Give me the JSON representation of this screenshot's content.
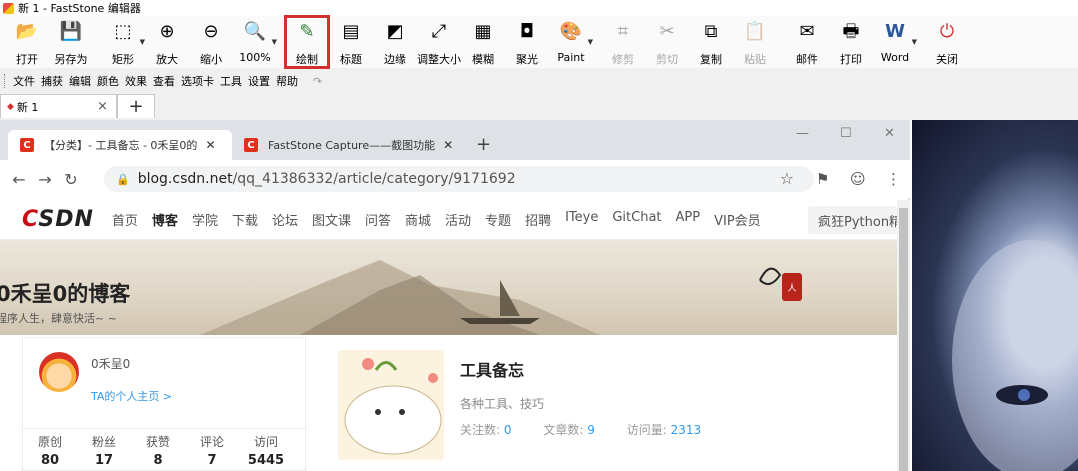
{
  "window": {
    "title": "新 1 - FastStone 编辑器"
  },
  "toolbar": {
    "tools": [
      {
        "label": "打开",
        "icon": "open-folder-icon",
        "glyph": "📂",
        "disabled": false,
        "caret": false,
        "highlight": false
      },
      {
        "label": "另存为",
        "icon": "save-icon",
        "glyph": "💾",
        "disabled": false,
        "caret": false,
        "highlight": false
      },
      {
        "label": "矩形",
        "icon": "rect-select-icon",
        "glyph": "⬚",
        "disabled": false,
        "caret": true,
        "highlight": false
      },
      {
        "label": "放大",
        "icon": "zoom-in-icon",
        "glyph": "⊕",
        "disabled": false,
        "caret": false,
        "highlight": false
      },
      {
        "label": "缩小",
        "icon": "zoom-out-icon",
        "glyph": "⊖",
        "disabled": false,
        "caret": false,
        "highlight": false
      },
      {
        "label": "100%",
        "icon": "zoom-100-icon",
        "glyph": "🔍",
        "disabled": false,
        "caret": true,
        "highlight": false
      },
      {
        "label": "绘制",
        "icon": "draw-icon",
        "glyph": "✎",
        "disabled": false,
        "caret": false,
        "highlight": true
      },
      {
        "label": "标题",
        "icon": "caption-icon",
        "glyph": "▤",
        "disabled": false,
        "caret": false,
        "highlight": false
      },
      {
        "label": "边缘",
        "icon": "edge-icon",
        "glyph": "◩",
        "disabled": false,
        "caret": false,
        "highlight": false
      },
      {
        "label": "调整大小",
        "icon": "resize-icon",
        "glyph": "⤢",
        "disabled": false,
        "caret": false,
        "highlight": false
      },
      {
        "label": "模糊",
        "icon": "blur-icon",
        "glyph": "▦",
        "disabled": false,
        "caret": false,
        "highlight": false
      },
      {
        "label": "聚光",
        "icon": "spotlight-icon",
        "glyph": "◘",
        "disabled": false,
        "caret": false,
        "highlight": false
      },
      {
        "label": "Paint",
        "icon": "paint-icon",
        "glyph": "🎨",
        "disabled": false,
        "caret": true,
        "highlight": false
      },
      {
        "label": "修剪",
        "icon": "crop-icon",
        "glyph": "⌗",
        "disabled": true,
        "caret": false,
        "highlight": false
      },
      {
        "label": "剪切",
        "icon": "cut-icon",
        "glyph": "✂",
        "disabled": true,
        "caret": false,
        "highlight": false
      },
      {
        "label": "复制",
        "icon": "copy-icon",
        "glyph": "⧉",
        "disabled": false,
        "caret": false,
        "highlight": false
      },
      {
        "label": "粘贴",
        "icon": "paste-icon",
        "glyph": "📋",
        "disabled": true,
        "caret": false,
        "highlight": false
      },
      {
        "label": "邮件",
        "icon": "mail-icon",
        "glyph": "✉",
        "disabled": false,
        "caret": false,
        "highlight": false
      },
      {
        "label": "打印",
        "icon": "print-icon",
        "glyph": "🖶",
        "disabled": false,
        "caret": false,
        "highlight": false
      },
      {
        "label": "Word",
        "icon": "word-icon",
        "glyph": "W",
        "disabled": false,
        "caret": true,
        "highlight": false
      },
      {
        "label": "关闭",
        "icon": "power-icon",
        "glyph": "⏻",
        "disabled": false,
        "caret": false,
        "highlight": false
      }
    ]
  },
  "menubar": {
    "items": [
      "文件",
      "捕获",
      "编辑",
      "颜色",
      "效果",
      "查看",
      "选项卡",
      "工具",
      "设置",
      "帮助"
    ]
  },
  "doctabs": {
    "active_label": "新 1"
  },
  "browser": {
    "tab1_title": "【分类】- 工具备忘 - 0禾呈0的",
    "tab2_title": "FastStone Capture——截图功能",
    "url_domain": "blog.csdn.net",
    "url_path": "/qq_41386332/article/category/9171692",
    "nav": [
      "首页",
      "博客",
      "学院",
      "下载",
      "论坛",
      "图文课",
      "问答",
      "商城",
      "活动",
      "专题",
      "招聘",
      "ITeye",
      "GitChat",
      "APP",
      "VIP会员"
    ],
    "nav_active": "博客",
    "search_text": "疯狂Python精",
    "blog_title": "0禾呈0的博客",
    "blog_sub": "程序人生，肆意快活~ ~",
    "profile": {
      "name": "0禾呈0",
      "home_link": "TA的个人主页 >",
      "stats": [
        {
          "k": "原创",
          "v": "80"
        },
        {
          "k": "粉丝",
          "v": "17"
        },
        {
          "k": "获赞",
          "v": "8"
        },
        {
          "k": "评论",
          "v": "7"
        },
        {
          "k": "访问",
          "v": "5445"
        }
      ]
    },
    "category": {
      "title": "工具备忘",
      "desc": "各种工具、技巧",
      "followers_label": "关注数:",
      "followers": "0",
      "articles_label": "文章数:",
      "articles": "9",
      "views_label": "访问量:",
      "views": "2313"
    }
  },
  "colors": {
    "highlight": "#d32f2f",
    "csdn_red": "#ca0c16",
    "link_blue": "#3399ea"
  }
}
